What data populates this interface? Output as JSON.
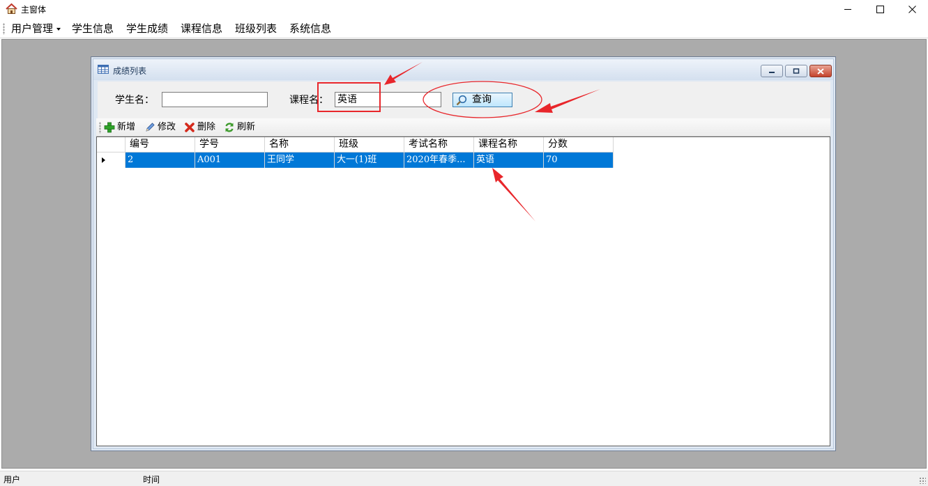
{
  "window": {
    "title": "主窗体",
    "icon": "home-icon"
  },
  "menu": {
    "items": [
      {
        "label": "用户管理",
        "has_dropdown": true
      },
      {
        "label": "学生信息"
      },
      {
        "label": "学生成绩"
      },
      {
        "label": "课程信息"
      },
      {
        "label": "班级列表"
      },
      {
        "label": "系统信息"
      }
    ]
  },
  "child_window": {
    "title": "成绩列表",
    "icon": "table-icon"
  },
  "search": {
    "student_label": "学生名：",
    "student_value": "",
    "course_label": "课程名：",
    "course_value": "英语",
    "query_label": "查询"
  },
  "toolbar": {
    "add_label": "新增",
    "edit_label": "修改",
    "delete_label": "删除",
    "refresh_label": "刷新"
  },
  "grid": {
    "columns": [
      "编号",
      "学号",
      "名称",
      "班级",
      "考试名称",
      "课程名称",
      "分数"
    ],
    "rows": [
      [
        "2",
        "A001",
        "王同学",
        "大一(1)班",
        "2020年春季...",
        "英语",
        "70"
      ]
    ]
  },
  "status": {
    "user_label": "用户",
    "time_label": "时间"
  },
  "colors": {
    "selection": "#0078d7",
    "annotation": "#e8262b",
    "mdi_background": "#ababab"
  }
}
